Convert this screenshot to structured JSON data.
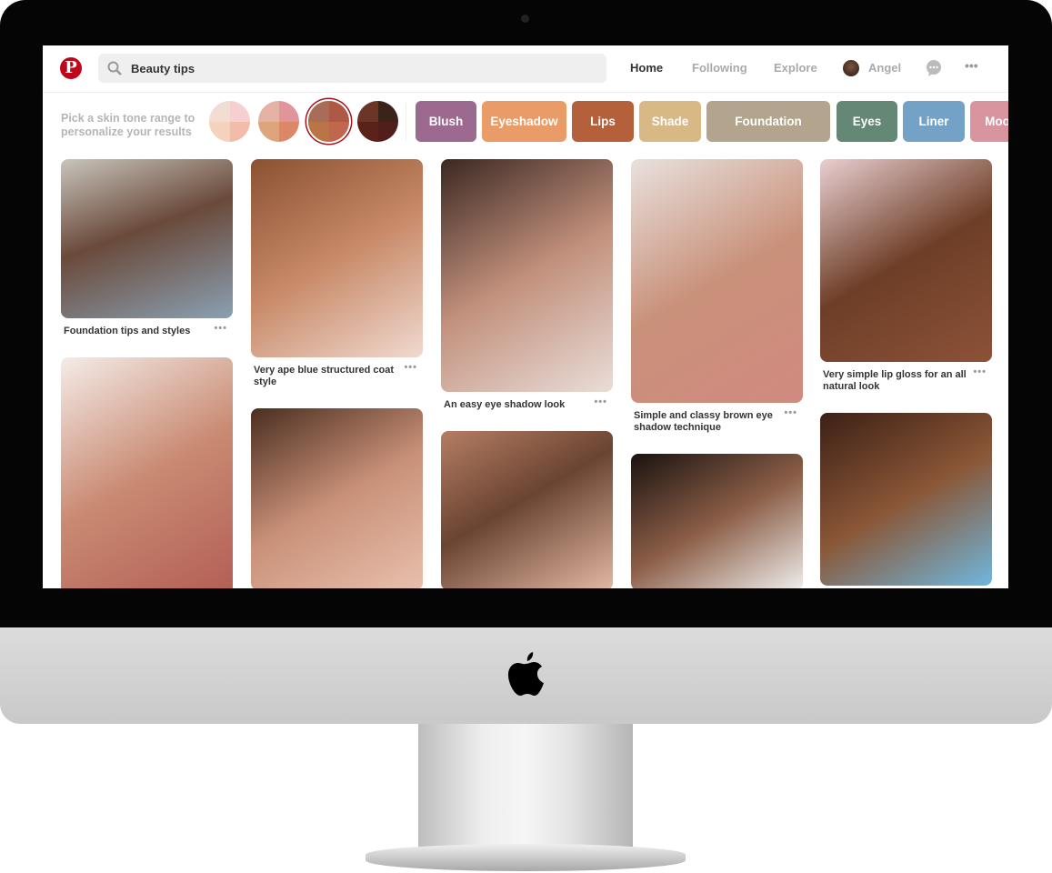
{
  "header": {
    "search_value": "Beauty tips",
    "nav": [
      "Home",
      "Following",
      "Explore"
    ],
    "user": "Angel",
    "active_tab": "Home"
  },
  "skin_tone": {
    "prompt": "Pick a skin tone range to personalize your results",
    "tones": [
      [
        "#f2ddd3",
        "#f6cfd3",
        "#f5d2bd",
        "#f3bca8"
      ],
      [
        "#e4b3a4",
        "#e0959a",
        "#dea57c",
        "#dc8868"
      ],
      [
        "#a86d57",
        "#ae5846",
        "#b97546",
        "#c0674e"
      ],
      [
        "#6b3528",
        "#3a2419",
        "#5a2219",
        "#521e1c"
      ]
    ],
    "selected": 2
  },
  "categories": [
    {
      "label": "Blush",
      "color": "#9c698f"
    },
    {
      "label": "Eyeshadow",
      "color": "#e99c68"
    },
    {
      "label": "Lips",
      "color": "#b3603b"
    },
    {
      "label": "Shade",
      "color": "#d8b985"
    },
    {
      "label": "Foundation",
      "color": "#b3a48e"
    },
    {
      "label": "Eyes",
      "color": "#658775"
    },
    {
      "label": "Liner",
      "color": "#74a1c6"
    },
    {
      "label": "Moo",
      "color": "#d8949f"
    }
  ],
  "pins": [
    {
      "caption": "Foundation tips and styles"
    },
    {
      "caption": "Very ape blue structured coat style"
    },
    {
      "caption": "An easy eye shadow look"
    },
    {
      "caption": "Simple and classy brown eye shadow technique"
    },
    {
      "caption": "Very simple lip gloss for an all natural look"
    }
  ],
  "more_label": "•••"
}
